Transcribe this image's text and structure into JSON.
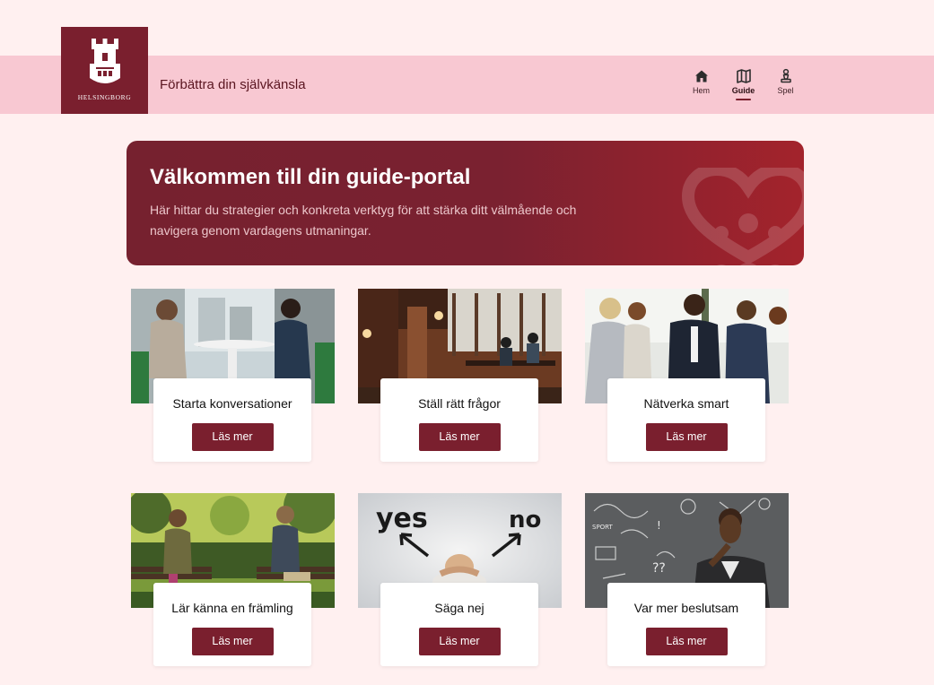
{
  "header": {
    "logo_text": "HELSINGBORG",
    "site_title": "Förbättra din självkänsla",
    "nav": [
      {
        "label": "Hem",
        "icon": "home-icon",
        "active": false
      },
      {
        "label": "Guide",
        "icon": "map-icon",
        "active": true
      },
      {
        "label": "Spel",
        "icon": "chess-pawn-icon",
        "active": false
      }
    ]
  },
  "hero": {
    "title": "Välkommen till din guide-portal",
    "text": "Här hittar du strategier och konkreta verktyg för att stärka ditt välmående och navigera genom vardagens utmaningar."
  },
  "cards": [
    {
      "title": "Starta konversationer",
      "button": "Läs mer"
    },
    {
      "title": "Ställ rätt frågor",
      "button": "Läs mer"
    },
    {
      "title": "Nätverka smart",
      "button": "Läs mer"
    },
    {
      "title": "Lär känna en främling",
      "button": "Läs mer"
    },
    {
      "title": "Säga nej",
      "button": "Läs mer"
    },
    {
      "title": "Var mer beslutsam",
      "button": "Läs mer"
    }
  ],
  "image_texts": {
    "yes": "yes",
    "no": "no"
  },
  "colors": {
    "background": "#fff0f0",
    "header_band": "#f8c8d2",
    "brand": "#7a1f2e",
    "hero_end": "#a3232c"
  }
}
